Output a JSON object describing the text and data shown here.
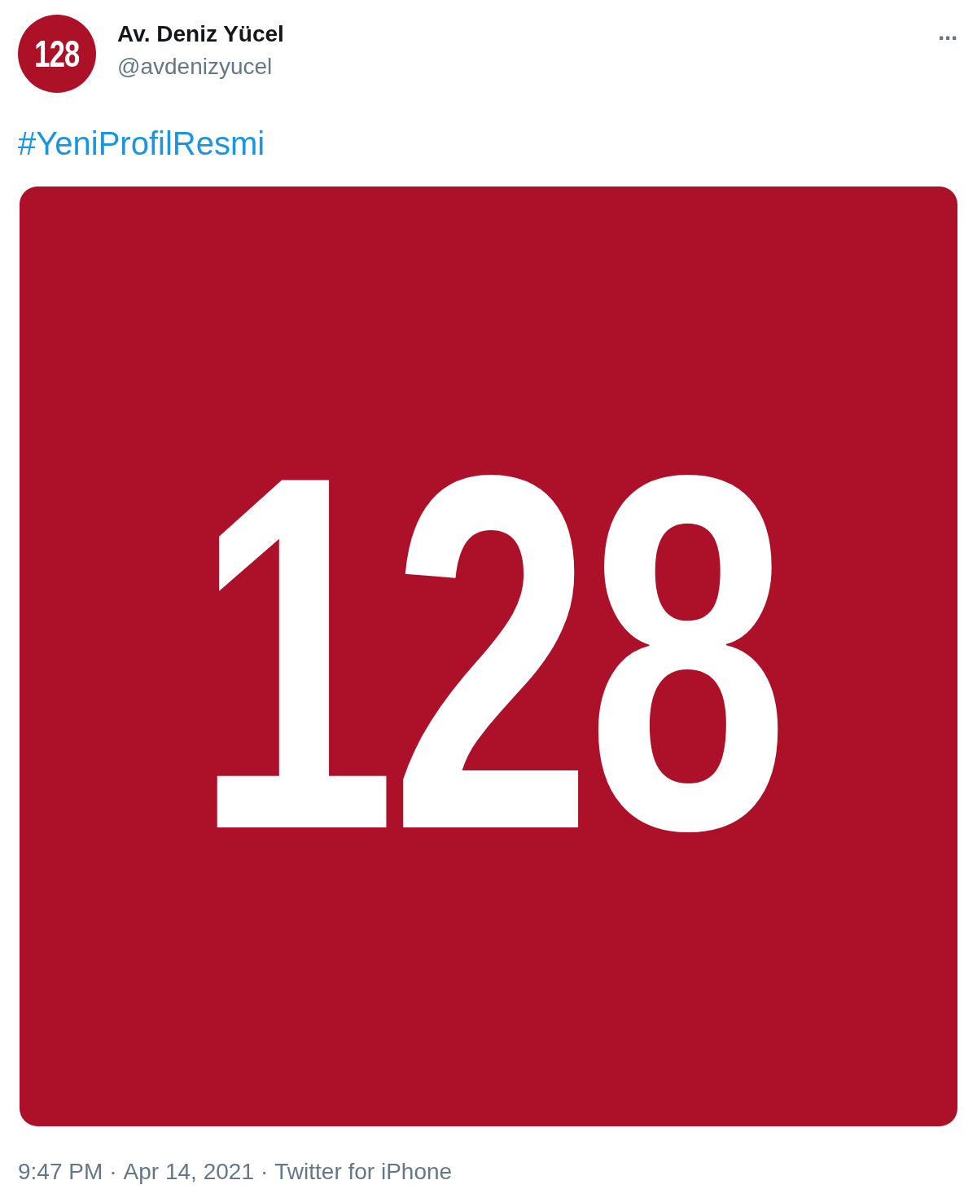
{
  "author": {
    "avatar_text": "128",
    "name": "Av. Deniz Yücel",
    "handle": "@avdenizyucel"
  },
  "more": "···",
  "hashtag": "#YeniProfilResmi",
  "image": {
    "text": "128"
  },
  "footer": {
    "time": "9:47 PM",
    "date": "Apr 14, 2021",
    "source": "Twitter for iPhone",
    "separator": "·"
  }
}
